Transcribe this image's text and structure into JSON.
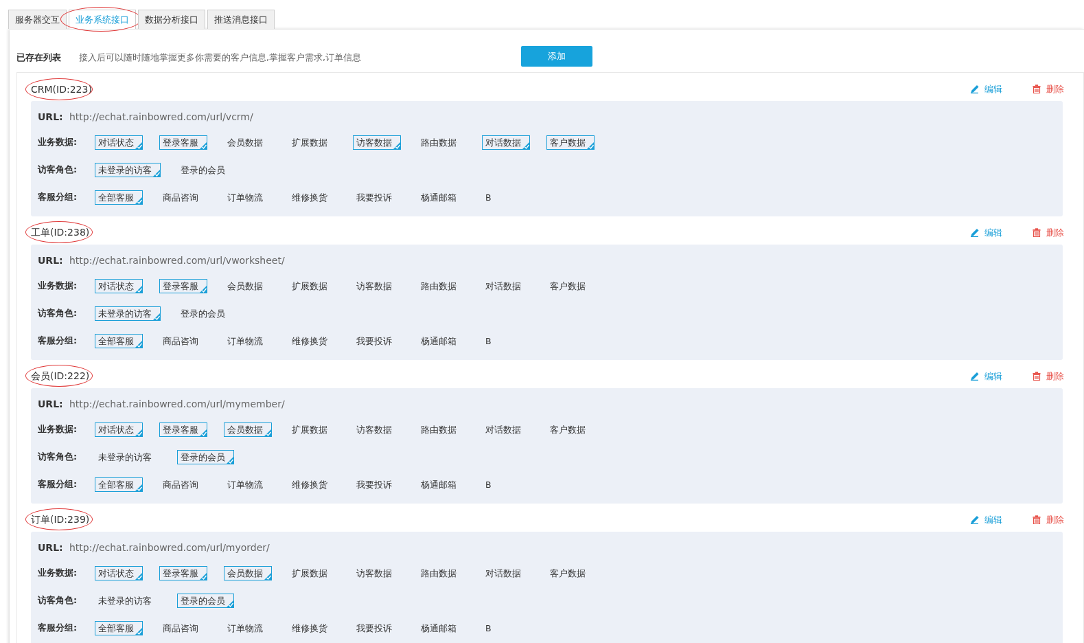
{
  "tabs": [
    {
      "label": "服务器交互",
      "selected": false,
      "annotated": false
    },
    {
      "label": "业务系统接口",
      "selected": true,
      "annotated": true
    },
    {
      "label": "数据分析接口",
      "selected": false,
      "annotated": false
    },
    {
      "label": "推送消息接口",
      "selected": false,
      "annotated": false
    }
  ],
  "header": {
    "title": "已存在列表",
    "hint": "接入后可以随时随地掌握更多你需要的客户信息,掌握客户需求,订单信息",
    "add_button": "添加"
  },
  "cards": [
    {
      "annotated": true,
      "title": "CRM(ID:223)",
      "edit": "编辑",
      "delete": "删除",
      "url_label": "URL:",
      "url": "http://echat.rainbowred.com/url/vcrm/",
      "rows": [
        {
          "label": "业务数据:",
          "options": [
            {
              "label": "对话状态",
              "checked": true
            },
            {
              "label": "登录客服",
              "checked": true
            },
            {
              "label": "会员数据",
              "checked": false
            },
            {
              "label": "扩展数据",
              "checked": false
            },
            {
              "label": "访客数据",
              "checked": true
            },
            {
              "label": "路由数据",
              "checked": false
            },
            {
              "label": "对话数据",
              "checked": true
            },
            {
              "label": "客户数据",
              "checked": true
            }
          ]
        },
        {
          "label": "访客角色:",
          "options": [
            {
              "label": "未登录的访客",
              "checked": true
            },
            {
              "label": "登录的会员",
              "checked": false
            }
          ]
        },
        {
          "label": "客服分组:",
          "options": [
            {
              "label": "全部客服",
              "checked": true
            },
            {
              "label": "商品咨询",
              "checked": false
            },
            {
              "label": "订单物流",
              "checked": false
            },
            {
              "label": "维修换货",
              "checked": false
            },
            {
              "label": "我要投诉",
              "checked": false
            },
            {
              "label": "杨通邮箱",
              "checked": false
            },
            {
              "label": "B",
              "checked": false
            }
          ]
        }
      ]
    },
    {
      "annotated": true,
      "title": "工单(ID:238)",
      "edit": "编辑",
      "delete": "删除",
      "url_label": "URL:",
      "url": "http://echat.rainbowred.com/url/vworksheet/",
      "rows": [
        {
          "label": "业务数据:",
          "options": [
            {
              "label": "对话状态",
              "checked": true
            },
            {
              "label": "登录客服",
              "checked": true
            },
            {
              "label": "会员数据",
              "checked": false
            },
            {
              "label": "扩展数据",
              "checked": false
            },
            {
              "label": "访客数据",
              "checked": false
            },
            {
              "label": "路由数据",
              "checked": false
            },
            {
              "label": "对话数据",
              "checked": false
            },
            {
              "label": "客户数据",
              "checked": false
            }
          ]
        },
        {
          "label": "访客角色:",
          "options": [
            {
              "label": "未登录的访客",
              "checked": true
            },
            {
              "label": "登录的会员",
              "checked": false
            }
          ]
        },
        {
          "label": "客服分组:",
          "options": [
            {
              "label": "全部客服",
              "checked": true
            },
            {
              "label": "商品咨询",
              "checked": false
            },
            {
              "label": "订单物流",
              "checked": false
            },
            {
              "label": "维修换货",
              "checked": false
            },
            {
              "label": "我要投诉",
              "checked": false
            },
            {
              "label": "杨通邮箱",
              "checked": false
            },
            {
              "label": "B",
              "checked": false
            }
          ]
        }
      ]
    },
    {
      "annotated": true,
      "title": "会员(ID:222)",
      "edit": "编辑",
      "delete": "删除",
      "url_label": "URL:",
      "url": "http://echat.rainbowred.com/url/mymember/",
      "rows": [
        {
          "label": "业务数据:",
          "options": [
            {
              "label": "对话状态",
              "checked": true
            },
            {
              "label": "登录客服",
              "checked": true
            },
            {
              "label": "会员数据",
              "checked": true
            },
            {
              "label": "扩展数据",
              "checked": false
            },
            {
              "label": "访客数据",
              "checked": false
            },
            {
              "label": "路由数据",
              "checked": false
            },
            {
              "label": "对话数据",
              "checked": false
            },
            {
              "label": "客户数据",
              "checked": false
            }
          ]
        },
        {
          "label": "访客角色:",
          "options": [
            {
              "label": "未登录的访客",
              "checked": false
            },
            {
              "label": "登录的会员",
              "checked": true
            }
          ]
        },
        {
          "label": "客服分组:",
          "options": [
            {
              "label": "全部客服",
              "checked": true
            },
            {
              "label": "商品咨询",
              "checked": false
            },
            {
              "label": "订单物流",
              "checked": false
            },
            {
              "label": "维修换货",
              "checked": false
            },
            {
              "label": "我要投诉",
              "checked": false
            },
            {
              "label": "杨通邮箱",
              "checked": false
            },
            {
              "label": "B",
              "checked": false
            }
          ]
        }
      ]
    },
    {
      "annotated": true,
      "title": "订单(ID:239)",
      "edit": "编辑",
      "delete": "删除",
      "url_label": "URL:",
      "url": "http://echat.rainbowred.com/url/myorder/",
      "rows": [
        {
          "label": "业务数据:",
          "options": [
            {
              "label": "对话状态",
              "checked": true
            },
            {
              "label": "登录客服",
              "checked": true
            },
            {
              "label": "会员数据",
              "checked": true
            },
            {
              "label": "扩展数据",
              "checked": false
            },
            {
              "label": "访客数据",
              "checked": false
            },
            {
              "label": "路由数据",
              "checked": false
            },
            {
              "label": "对话数据",
              "checked": false
            },
            {
              "label": "客户数据",
              "checked": false
            }
          ]
        },
        {
          "label": "访客角色:",
          "options": [
            {
              "label": "未登录的访客",
              "checked": false
            },
            {
              "label": "登录的会员",
              "checked": true
            }
          ]
        },
        {
          "label": "客服分组:",
          "options": [
            {
              "label": "全部客服",
              "checked": true
            },
            {
              "label": "商品咨询",
              "checked": false
            },
            {
              "label": "订单物流",
              "checked": false
            },
            {
              "label": "维修换货",
              "checked": false
            },
            {
              "label": "我要投诉",
              "checked": false
            },
            {
              "label": "杨通邮箱",
              "checked": false
            },
            {
              "label": "B",
              "checked": false
            }
          ]
        }
      ]
    }
  ]
}
